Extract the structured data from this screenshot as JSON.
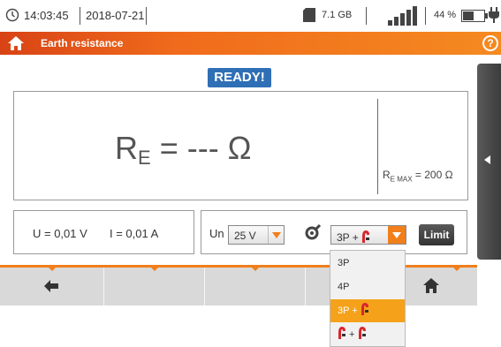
{
  "status_bar": {
    "time": "14:03:45",
    "date": "2018-07-21",
    "storage": "7.1 GB",
    "battery": "44 %",
    "icons": [
      "clock-icon",
      "sd-card-icon",
      "signal-icon",
      "battery-icon",
      "plug-icon"
    ]
  },
  "title_bar": {
    "title": "Earth resistance",
    "help": "?",
    "icons": [
      "home-icon",
      "help-icon"
    ]
  },
  "status_badge": "READY!",
  "result": {
    "symbol": "R",
    "subscript": "E",
    "value_text": " = --- Ω",
    "remax_symbol": "R",
    "remax_subscript": "E MAX",
    "remax_value": " = 200 Ω"
  },
  "readings": {
    "voltage": "U = 0,01 V",
    "current": "I = 0,01 A"
  },
  "controls": {
    "un_label": "Un",
    "un_value": "25 V",
    "method_value": "3P + ",
    "limit_label": "Limit"
  },
  "method_options": [
    {
      "label": "3P",
      "clamp": false
    },
    {
      "label": "4P",
      "clamp": false
    },
    {
      "label": "3P + ",
      "clamp": true,
      "selected": true
    },
    {
      "label": " + ",
      "clamp": true,
      "double": true
    }
  ],
  "bottom_nav": {
    "icons": [
      "back-arrow-icon",
      "home-icon"
    ]
  },
  "colors": {
    "accent": "#f07f1c",
    "badge": "#2f6fb5",
    "selected_option": "#f5a21a",
    "clamp_red": "#d8262b"
  }
}
